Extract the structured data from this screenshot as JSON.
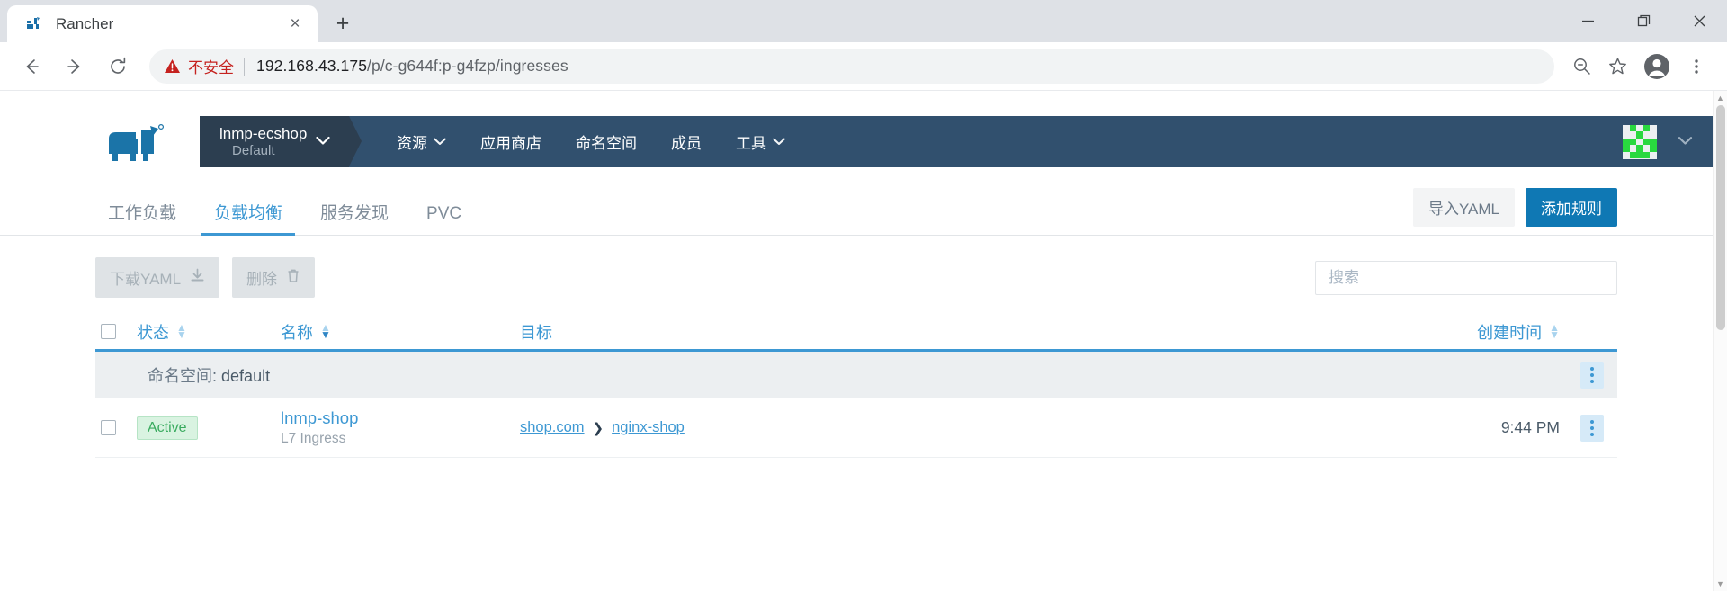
{
  "browser": {
    "tab": {
      "title": "Rancher",
      "favicon": "rancher-logo-icon",
      "close": "×"
    },
    "new_tab_label": "+",
    "window_controls": {
      "minimize": "minimize-icon",
      "maximize": "maximize-icon",
      "close": "close-icon"
    },
    "nav": {
      "back": "back-arrow-icon",
      "forward": "forward-arrow-icon",
      "reload": "reload-icon"
    },
    "omnibox": {
      "security_label": "不安全",
      "url_host": "192.168.43.175",
      "url_path": "/p/c-g644f:p-g4fzp/ingresses",
      "full_url": "192.168.43.175/p/c-g644f:p-g4fzp/ingresses"
    },
    "right_icons": {
      "zoom": "zoom-out-icon",
      "bookmark": "star-icon",
      "profile": "profile-avatar-icon",
      "menu": "three-dot-menu-icon"
    }
  },
  "rancher": {
    "logo": "rancher-cow-logo",
    "cluster": {
      "project": "lnmp-ecshop",
      "cluster": "Default",
      "caret": "⌄"
    },
    "menu": [
      {
        "label": "资源",
        "has_caret": true
      },
      {
        "label": "应用商店",
        "has_caret": false
      },
      {
        "label": "命名空间",
        "has_caret": false
      },
      {
        "label": "成员",
        "has_caret": false
      },
      {
        "label": "工具",
        "has_caret": true
      }
    ],
    "user": {
      "avatar": "identicon-avatar",
      "caret": "⌄"
    },
    "colors": {
      "header_bg": "#31506e",
      "cluster_bg": "#2c3e50",
      "accent": "#3d98d3",
      "primary_button": "#0f78b4"
    }
  },
  "page_tabs": {
    "items": [
      {
        "label": "工作负载",
        "active": false
      },
      {
        "label": "负载均衡",
        "active": true
      },
      {
        "label": "服务发现",
        "active": false
      },
      {
        "label": "PVC",
        "active": false
      }
    ],
    "import_yaml": "导入YAML",
    "add_rule": "添加规则"
  },
  "toolbar": {
    "download_yaml": "下载YAML",
    "download_icon": "download-icon",
    "delete": "删除",
    "delete_icon": "trash-icon",
    "search_placeholder": "搜索",
    "search_value": ""
  },
  "table": {
    "columns": [
      {
        "key": "state",
        "label": "状态",
        "sortable": true,
        "sort_active": false
      },
      {
        "key": "name",
        "label": "名称",
        "sortable": true,
        "sort_active": true
      },
      {
        "key": "target",
        "label": "目标",
        "sortable": false,
        "sort_active": false
      },
      {
        "key": "created",
        "label": "创建时间",
        "sortable": true,
        "sort_active": false
      }
    ],
    "group": {
      "label": "命名空间",
      "separator": ":",
      "value": "default",
      "menu_icon": "kebab-menu-icon"
    },
    "rows": [
      {
        "state": "Active",
        "name": "lnmp-shop",
        "subtitle": "L7 Ingress",
        "target_host": "shop.com",
        "target_chevron": "❯",
        "target_service": "nginx-shop",
        "created": "9:44 PM",
        "menu_icon": "kebab-menu-icon"
      }
    ]
  }
}
